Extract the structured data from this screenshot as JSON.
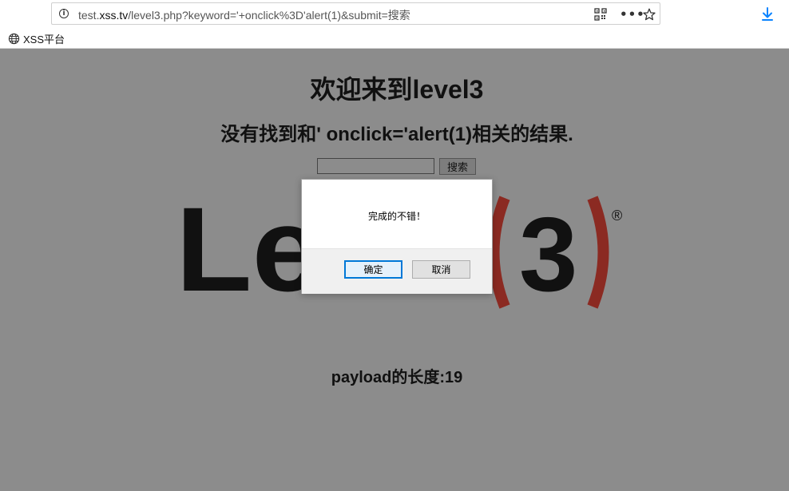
{
  "browser": {
    "url_prefix": "test.",
    "url_host": "xss.tv",
    "url_path": "/level3.php?keyword='+onclick%3D'alert(1)&submit=搜索",
    "bookmark_label": "XSS平台"
  },
  "page": {
    "title": "欢迎来到level3",
    "result_text": "没有找到和' onclick='alert(1)相关的结果.",
    "input_value": "",
    "search_button": "搜索",
    "payload_length": "payload的长度:19"
  },
  "logo": {
    "text": "Level",
    "number": "3",
    "registered": "®",
    "accent_color": "#8b2a22",
    "dark_color": "#111111"
  },
  "dialog": {
    "message": "完成的不错！",
    "ok_label": "确定",
    "cancel_label": "取消"
  }
}
